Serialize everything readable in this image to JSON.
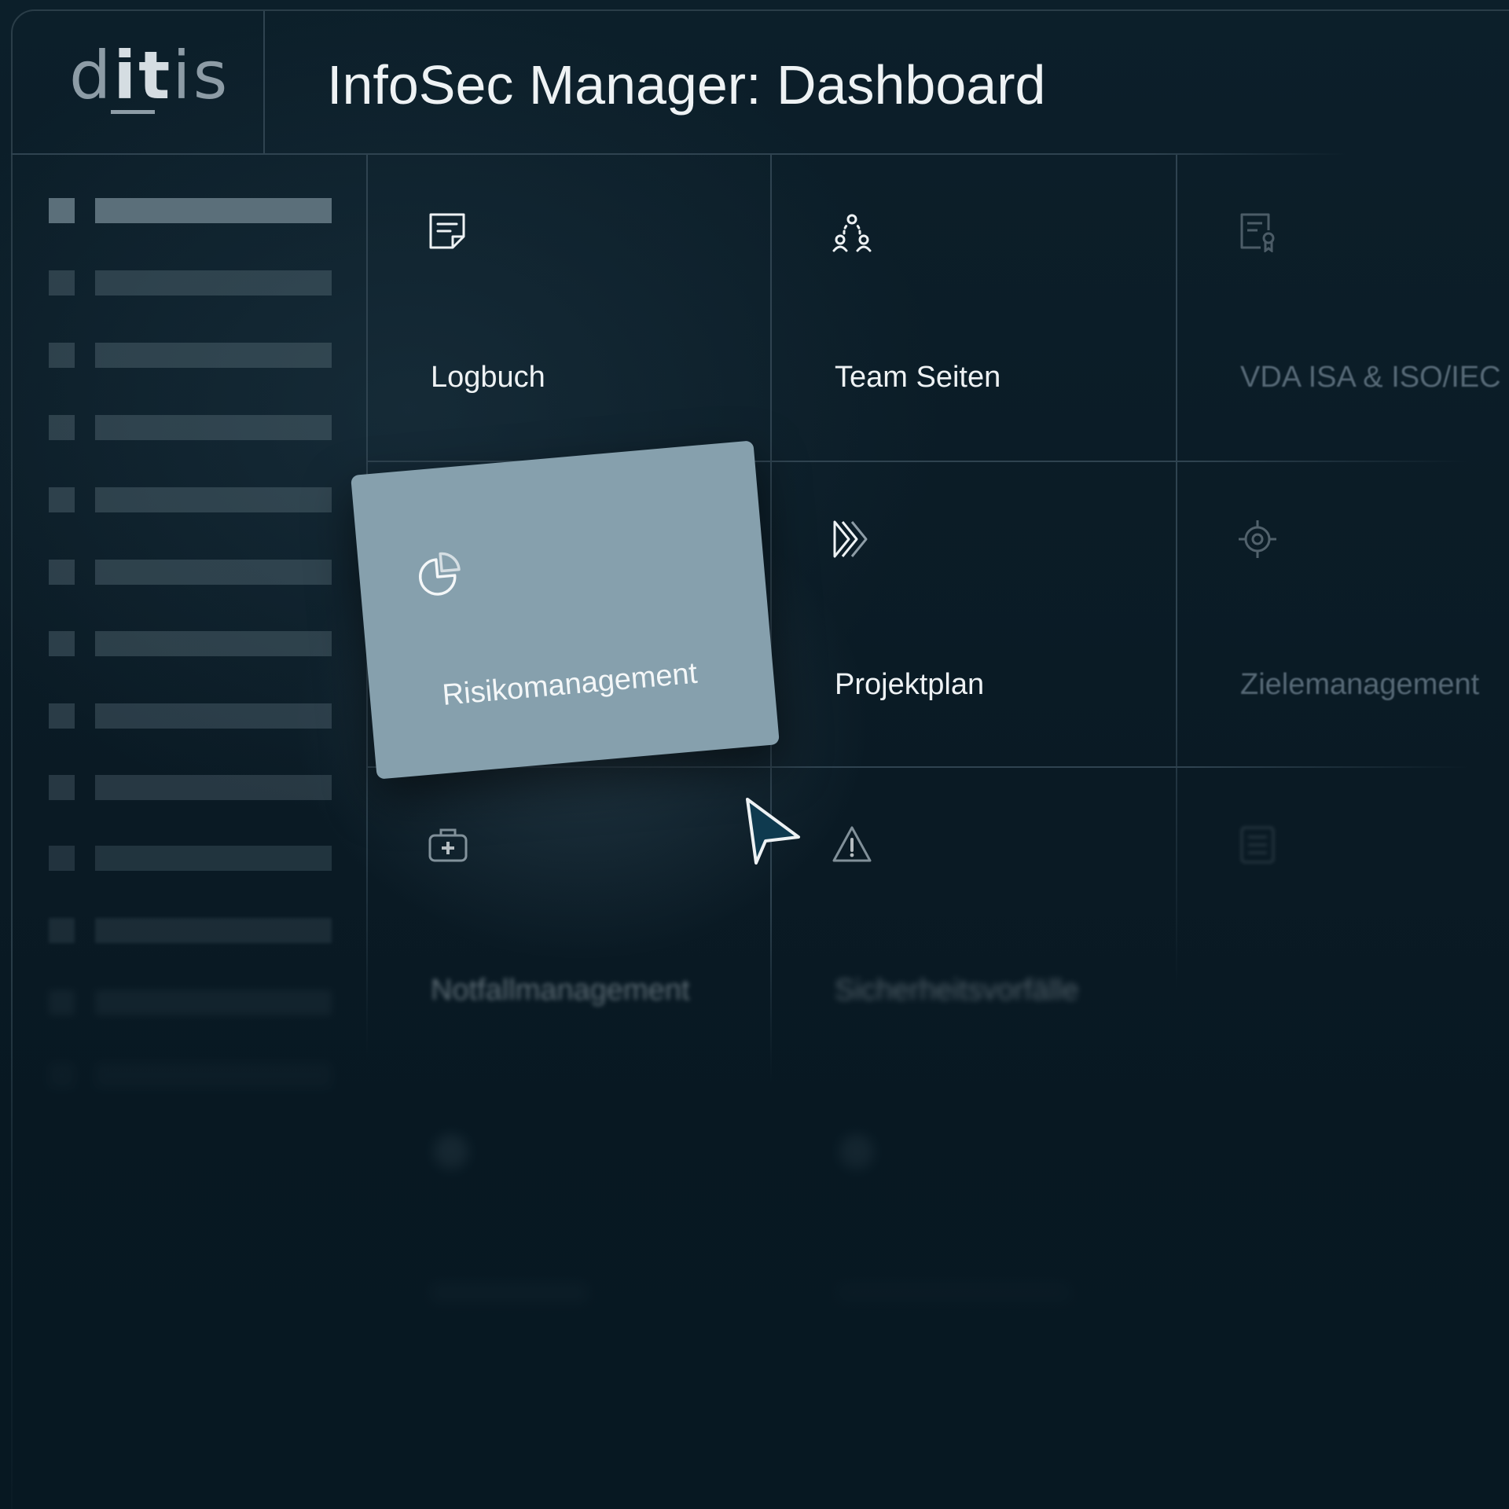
{
  "app": {
    "logo_parts": [
      "d",
      "it",
      "is"
    ],
    "title": "InfoSec Manager: Dashboard"
  },
  "colors": {
    "background": "#0a1a24",
    "grid_line": "#2f4350",
    "card_dragging": "#86a0ad",
    "text_primary": "#eef2f4",
    "cursor_fill": "#0f3a4f"
  },
  "sidebar": {
    "items": [
      {
        "state": "active"
      },
      {
        "state": "idle"
      },
      {
        "state": "idle"
      },
      {
        "state": "idle"
      },
      {
        "state": "idle"
      },
      {
        "state": "idle"
      },
      {
        "state": "idle"
      },
      {
        "state": "idle"
      },
      {
        "state": "idle"
      },
      {
        "state": "idle"
      },
      {
        "state": "idle"
      },
      {
        "state": "idle"
      },
      {
        "state": "idle"
      }
    ]
  },
  "tiles": [
    {
      "label": "Logbuch",
      "icon": "note-icon"
    },
    {
      "label": "Team Seiten",
      "icon": "team-icon"
    },
    {
      "label": "VDA ISA & ISO/IEC",
      "icon": "certificate-icon"
    },
    {
      "label": "Projektplan",
      "icon": "fast-forward-icon"
    },
    {
      "label": "Zielemanagement",
      "icon": "target-icon"
    },
    {
      "label": "Notfallmanagement",
      "icon": "first-aid-kit-icon"
    },
    {
      "label": "Sicherheitsvorfälle",
      "icon": "warning-icon"
    },
    {
      "label": "",
      "icon": "checklist-icon"
    }
  ],
  "dragging_card": {
    "label": "Risikomanagement",
    "icon": "pie-chart-icon"
  },
  "cursor": {
    "icon": "mouse-pointer-icon"
  }
}
